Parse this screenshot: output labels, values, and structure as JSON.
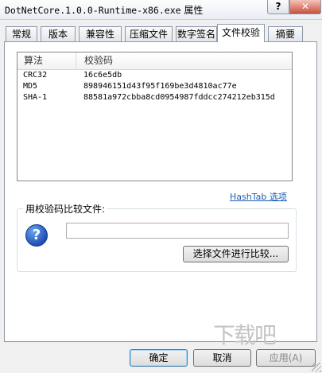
{
  "window": {
    "title_filename": "DotNetCore.1.0.0-Runtime-x86.exe",
    "title_suffix": "属性",
    "help_label": "?",
    "close_label": "✕"
  },
  "tabs": [
    "常规",
    "版本",
    "兼容性",
    "压缩文件",
    "数字签名",
    "文件校验",
    "摘要"
  ],
  "active_tab": "文件校验",
  "hash_list": {
    "columns": [
      "算法",
      "校验码"
    ],
    "rows": [
      {
        "algorithm": "CRC32",
        "value": "16c6e5db"
      },
      {
        "algorithm": "MD5",
        "value": "898946151d43f95f169be3d4810ac77e"
      },
      {
        "algorithm": "SHA-1",
        "value": "88581a972cbba8cd0954987fddcc274212eb315d"
      }
    ]
  },
  "hashtab_link": "HashTab 选项",
  "compare": {
    "label": "用校验码比较文件:",
    "input_value": "",
    "button_label": "选择文件进行比较..."
  },
  "footer": {
    "ok": "确定",
    "cancel": "取消",
    "apply": "应用(A)"
  },
  "watermark": "下载吧",
  "icons": {
    "question": "question-icon",
    "resize": "resize-grip-icon"
  }
}
